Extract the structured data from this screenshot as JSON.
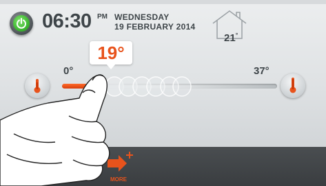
{
  "header": {
    "time": "06:30",
    "ampm": "PM",
    "day": "WEDNESDAY",
    "date": "19 FEBRUARY 2014"
  },
  "indoor": {
    "temperature": "21",
    "unit": "°"
  },
  "slider": {
    "selected_value": "19°",
    "min_label": "0°",
    "max_label": "37°",
    "min": 0,
    "max": 37,
    "value": 19
  },
  "bottom_bar": {
    "more_label": "MORE"
  },
  "icons": {
    "power": "power-icon",
    "house": "house-icon",
    "thermometer": "thermometer-icon",
    "more": "arrow-plus-icon"
  },
  "colors": {
    "accent": "#e8531c",
    "power_green": "#3fb833",
    "text_dark": "#3e4549",
    "bar_dark": "#3a3d40"
  }
}
